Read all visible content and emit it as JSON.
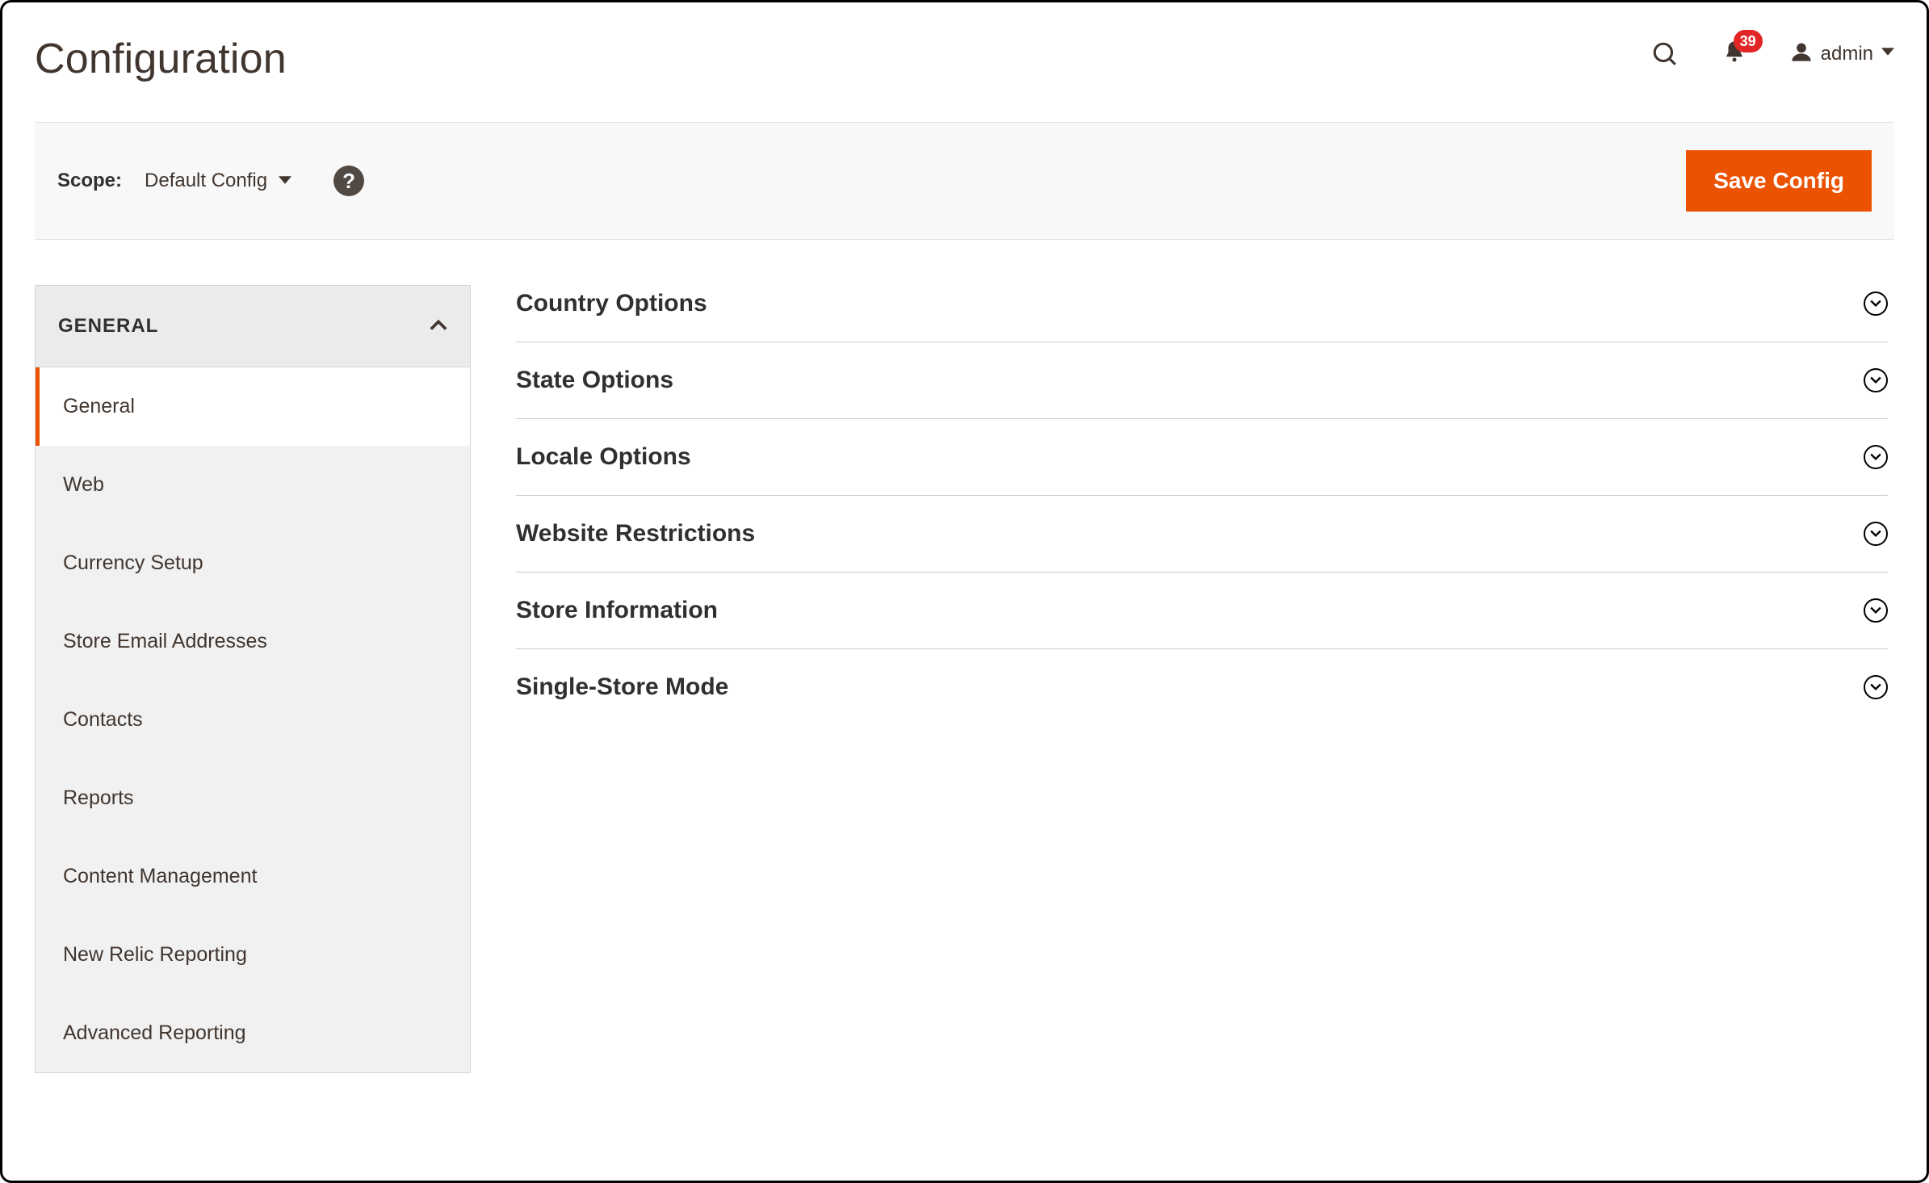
{
  "page": {
    "title": "Configuration"
  },
  "header": {
    "notification_count": "39",
    "user_name": "admin"
  },
  "toolbar": {
    "scope_label": "Scope:",
    "scope_value": "Default Config",
    "save_label": "Save Config"
  },
  "sidebar": {
    "group_title": "GENERAL",
    "items": [
      {
        "label": "General"
      },
      {
        "label": "Web"
      },
      {
        "label": "Currency Setup"
      },
      {
        "label": "Store Email Addresses"
      },
      {
        "label": "Contacts"
      },
      {
        "label": "Reports"
      },
      {
        "label": "Content Management"
      },
      {
        "label": "New Relic Reporting"
      },
      {
        "label": "Advanced Reporting"
      }
    ]
  },
  "sections": [
    {
      "title": "Country Options"
    },
    {
      "title": "State Options"
    },
    {
      "title": "Locale Options"
    },
    {
      "title": "Website Restrictions"
    },
    {
      "title": "Store Information"
    },
    {
      "title": "Single-Store Mode"
    }
  ],
  "colors": {
    "accent": "#eb5202",
    "badge": "#e22626"
  }
}
